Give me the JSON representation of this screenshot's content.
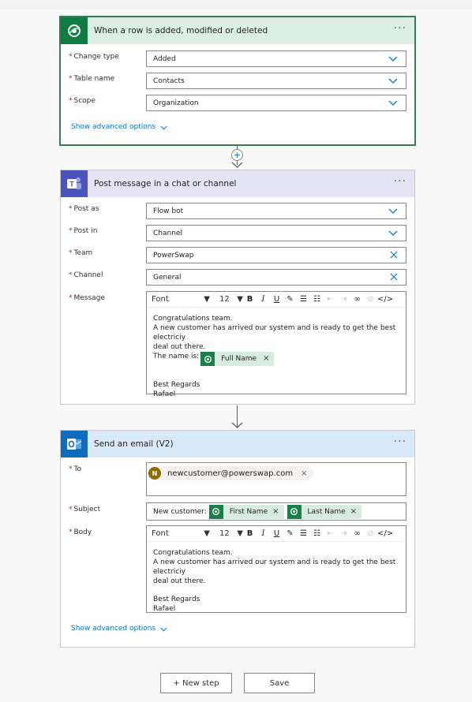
{
  "trigger": {
    "title": "When a row is added, modified or deleted",
    "more": "···",
    "fields": [
      {
        "label": "Change type",
        "value": "Added",
        "control": "dropdown"
      },
      {
        "label": "Table name",
        "value": "Contacts",
        "control": "dropdown"
      },
      {
        "label": "Scope",
        "value": "Organization",
        "control": "dropdown"
      }
    ],
    "advanced_label": "Show advanced options",
    "icon": "dataverse-icon",
    "header_color": "#dcefe5"
  },
  "connector_plus": "+",
  "teams": {
    "title": "Post message in a chat or channel",
    "more": "···",
    "fields": [
      {
        "label": "Post as",
        "value": "Flow bot",
        "control": "dropdown"
      },
      {
        "label": "Post in",
        "value": "Channel",
        "control": "dropdown"
      },
      {
        "label": "Team",
        "value": "PowerSwap",
        "control": "clear"
      },
      {
        "label": "Channel",
        "value": "General",
        "control": "clear"
      }
    ],
    "message_label": "Message",
    "editor": {
      "font": "Font",
      "size": "12"
    },
    "message_lines": [
      "Congratulations team.",
      "A new customer has arrived our system and is ready to get the best electriciy",
      "deal out there.",
      "The name is:"
    ],
    "token": "Full Name",
    "sign_lines": [
      "Best Regards",
      "Rafael"
    ],
    "icon": "teams-icon",
    "header_color": "#e4e4f5"
  },
  "email": {
    "title": "Send an email (V2)",
    "more": "···",
    "to_label": "To",
    "recipient_initial": "N",
    "recipient": "newcustomer@powerswap.com",
    "subject_label": "Subject",
    "subject_prefix": "New customer:",
    "subject_tokens": [
      "First Name",
      "Last Name"
    ],
    "body_label": "Body",
    "editor": {
      "font": "Font",
      "size": "12"
    },
    "body_lines": [
      "Congratulations team.",
      "A new customer has arrived our system and is ready to get the best electriciy",
      "deal out there."
    ],
    "sign_lines": [
      "Best Regards",
      "Rafael"
    ],
    "advanced_label": "Show advanced options",
    "icon": "outlook-icon",
    "header_color": "#d9e9f7"
  },
  "footer": {
    "new_step": "+ New step",
    "save": "Save"
  }
}
